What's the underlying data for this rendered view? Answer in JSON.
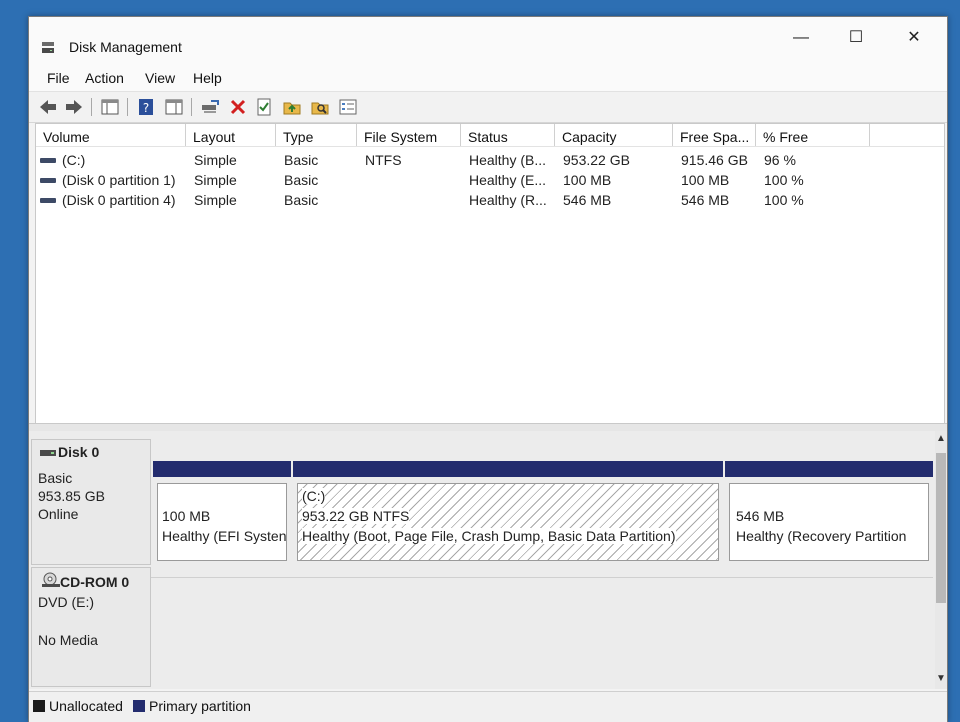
{
  "window": {
    "title": "Disk Management",
    "minimize_glyph": "—",
    "maximize_glyph": "☐",
    "close_glyph": "✕"
  },
  "menu": [
    "File",
    "Action",
    "View",
    "Help"
  ],
  "toolbar_icons": [
    "back-arrow-icon",
    "forward-arrow-icon",
    "console-tree-icon",
    "help-icon",
    "show-hide-pane-icon",
    "connect-drive-icon",
    "delete-icon",
    "check-icon",
    "open-folder-icon",
    "explore-icon",
    "properties-icon"
  ],
  "volume_list": {
    "columns": [
      "Volume",
      "Layout",
      "Type",
      "File System",
      "Status",
      "Capacity",
      "Free Spa...",
      "% Free"
    ],
    "rows": [
      [
        "(C:)",
        "Simple",
        "Basic",
        "NTFS",
        "Healthy (B...",
        "953.22 GB",
        "915.46 GB",
        "96 %"
      ],
      [
        "(Disk 0 partition 1)",
        "Simple",
        "Basic",
        "",
        "Healthy (E...",
        "100 MB",
        "100 MB",
        "100 %"
      ],
      [
        "(Disk 0 partition 4)",
        "Simple",
        "Basic",
        "",
        "Healthy (R...",
        "546 MB",
        "546 MB",
        "100 %"
      ]
    ]
  },
  "disks": [
    {
      "name": "Disk 0",
      "type": "Basic",
      "size": "953.85 GB",
      "state": "Online",
      "partitions": [
        {
          "title": "",
          "size": "100 MB",
          "status": "Healthy (EFI Systen"
        },
        {
          "title": "(C:)",
          "size": "953.22 GB NTFS",
          "status": "Healthy (Boot, Page File, Crash Dump, Basic Data Partition)"
        },
        {
          "title": "",
          "size": "546 MB",
          "status": "Healthy (Recovery Partition"
        }
      ]
    },
    {
      "name": "CD-ROM 0",
      "type": "DVD (E:)",
      "media": "No Media"
    }
  ],
  "legend": [
    {
      "label": "Unallocated",
      "color": "#1a1a1a"
    },
    {
      "label": "Primary partition",
      "color": "#232c6e"
    }
  ]
}
